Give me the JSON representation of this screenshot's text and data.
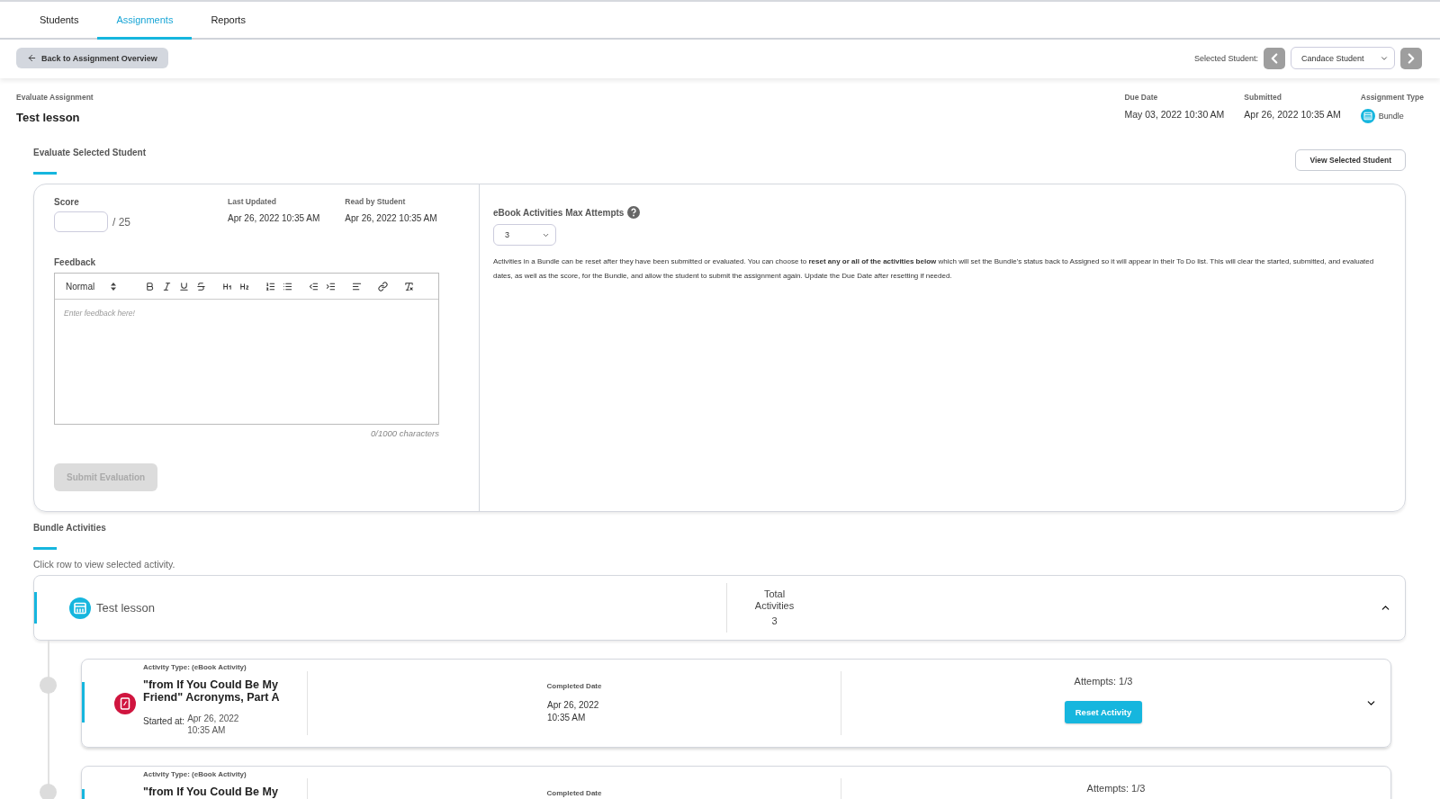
{
  "tabs": [
    {
      "label": "Students",
      "selected": false
    },
    {
      "label": "Assignments",
      "selected": true
    },
    {
      "label": "Reports",
      "selected": false
    }
  ],
  "back_button": "Back to Assignment Overview",
  "student_picker": {
    "label": "Selected Student:",
    "value": "Candace Student"
  },
  "header": {
    "caption": "Evaluate Assignment",
    "title": "Test lesson",
    "meta": [
      {
        "label": "Due Date",
        "value": "May 03, 2022 10:30 AM",
        "kind": "text"
      },
      {
        "label": "Submitted",
        "value": "Apr 26, 2022 10:35 AM",
        "kind": "text"
      },
      {
        "label": "Assignment Type",
        "value": "Bundle",
        "kind": "type"
      }
    ]
  },
  "evaluate_section": {
    "heading": "Evaluate Selected Student",
    "view_button": "View Selected Student"
  },
  "evaluation": {
    "score_label": "Score",
    "score_max": "/ 25",
    "dates": [
      {
        "label": "Last Updated",
        "value": "Apr 26, 2022 10:35 AM"
      },
      {
        "label": "Read by Student",
        "value": "Apr 26, 2022 10:35 AM"
      }
    ],
    "feedback_label": "Feedback",
    "format": "Normal",
    "placeholder": "Enter feedback here!",
    "counter": "0/1000 characters",
    "submit": {
      "label": "Submit Evaluation",
      "disabled": true
    }
  },
  "attempts": {
    "label": "eBook Activities Max Attempts",
    "value": "3",
    "note": "Activities in a Bundle can be reset after they have been submitted or evaluated. You can choose to **reset any or all of the activities below** which will set the Bundle's status back to Assigned so it will appear in their To Do list. This will clear the started, submitted, and evaluated dates, as well as the score, for the Bundle, and allow the student to submit the assignment again. Update the Due Date after resetting if needed."
  },
  "bundle_section": {
    "heading": "Bundle Activities",
    "hint": "Click row to view selected activity.",
    "bundle": {
      "title": "Test lesson",
      "total_label": "Total Activities",
      "total": "3",
      "expanded": true
    }
  },
  "activities": [
    {
      "type": "Activity Type: (eBook Activity)",
      "title": "\"from If You Could Be My Friend\" Acronyms, Part A",
      "started_label": "Started at:",
      "started_date": "Apr 26, 2022",
      "started_time": "10:35 AM",
      "completed_label": "Completed Date",
      "completed_date": "Apr 26, 2022",
      "completed_time": "10:35 AM",
      "attempts": "Attempts: 1/3",
      "button": "Reset Activity",
      "expanded": false
    },
    {
      "type": "Activity Type: (eBook Activity)",
      "title": "\"from If You Could Be My",
      "completed_label": "Completed Date",
      "attempts": "Attempts: 1/3"
    }
  ]
}
